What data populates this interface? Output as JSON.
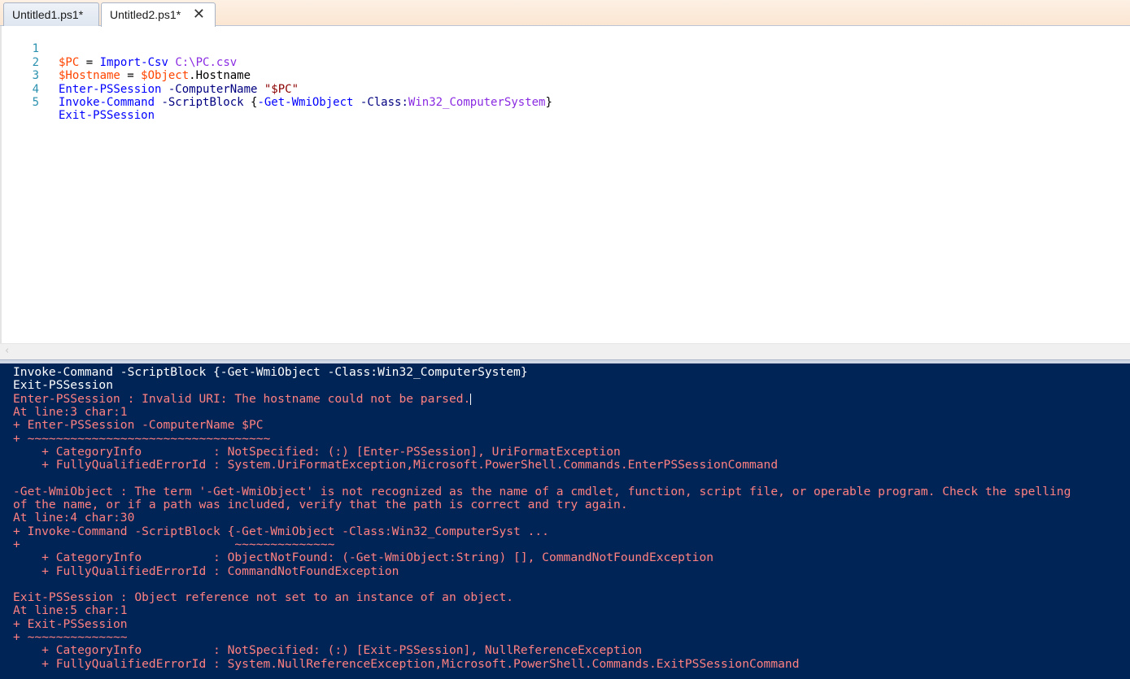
{
  "tabs": [
    {
      "label": "Untitled1.ps1*"
    },
    {
      "label": "Untitled2.ps1*",
      "close": "✕"
    }
  ],
  "editor": {
    "lines": [
      {
        "num": "1"
      },
      {
        "num": "2"
      },
      {
        "num": "3"
      },
      {
        "num": "4"
      },
      {
        "num": "5"
      }
    ],
    "tokens": {
      "l1a": "$PC",
      "l1b": " = ",
      "l1c": "Import-Csv",
      "l1d": " C:\\PC.csv",
      "l2a": "$Hostname",
      "l2b": " = ",
      "l2c": "$Object",
      "l2d": ".Hostname",
      "l3a": "Enter-PSSession",
      "l3b": " -ComputerName",
      "l3c": " \"$PC\"",
      "l4a": "Invoke-Command",
      "l4b": " -ScriptBlock",
      "l4c": " {",
      "l4d": "-Get-WmiObject",
      "l4e": " -Class:",
      "l4f": "Win32_ComputerSystem",
      "l4g": "}",
      "l5a": "Exit-PSSession"
    }
  },
  "scroll": {
    "left_arrow": "‹"
  },
  "console": {
    "lines": [
      {
        "text": "Invoke-Command -ScriptBlock {-Get-WmiObject -Class:Win32_ComputerSystem}",
        "kind": "norm"
      },
      {
        "text": "Exit-PSSession",
        "kind": "norm"
      },
      {
        "text": "Enter-PSSession : Invalid URI: The hostname could not be parsed.",
        "kind": "err"
      },
      {
        "text": "At line:3 char:1",
        "kind": "err"
      },
      {
        "text": "+ Enter-PSSession -ComputerName $PC",
        "kind": "err"
      },
      {
        "text": "+ ~~~~~~~~~~~~~~~~~~~~~~~~~~~~~~~~~~",
        "kind": "err"
      },
      {
        "text": "    + CategoryInfo          : NotSpecified: (:) [Enter-PSSession], UriFormatException",
        "kind": "err"
      },
      {
        "text": "    + FullyQualifiedErrorId : System.UriFormatException,Microsoft.PowerShell.Commands.EnterPSSessionCommand",
        "kind": "err"
      },
      {
        "text": "",
        "kind": "err"
      },
      {
        "text": "-Get-WmiObject : The term '-Get-WmiObject' is not recognized as the name of a cmdlet, function, script file, or operable program. Check the spelling",
        "kind": "err"
      },
      {
        "text": "of the name, or if a path was included, verify that the path is correct and try again.",
        "kind": "err"
      },
      {
        "text": "At line:4 char:30",
        "kind": "err"
      },
      {
        "text": "+ Invoke-Command -ScriptBlock {-Get-WmiObject -Class:Win32_ComputerSyst ...",
        "kind": "err"
      },
      {
        "text": "+                              ~~~~~~~~~~~~~~",
        "kind": "err"
      },
      {
        "text": "    + CategoryInfo          : ObjectNotFound: (-Get-WmiObject:String) [], CommandNotFoundException",
        "kind": "err"
      },
      {
        "text": "    + FullyQualifiedErrorId : CommandNotFoundException",
        "kind": "err"
      },
      {
        "text": "",
        "kind": "err"
      },
      {
        "text": "Exit-PSSession : Object reference not set to an instance of an object.",
        "kind": "err"
      },
      {
        "text": "At line:5 char:1",
        "kind": "err"
      },
      {
        "text": "+ Exit-PSSession",
        "kind": "err"
      },
      {
        "text": "+ ~~~~~~~~~~~~~~",
        "kind": "err"
      },
      {
        "text": "    + CategoryInfo          : NotSpecified: (:) [Exit-PSSession], NullReferenceException",
        "kind": "err"
      },
      {
        "text": "    + FullyQualifiedErrorId : System.NullReferenceException,Microsoft.PowerShell.Commands.ExitPSSessionCommand",
        "kind": "err"
      }
    ]
  }
}
